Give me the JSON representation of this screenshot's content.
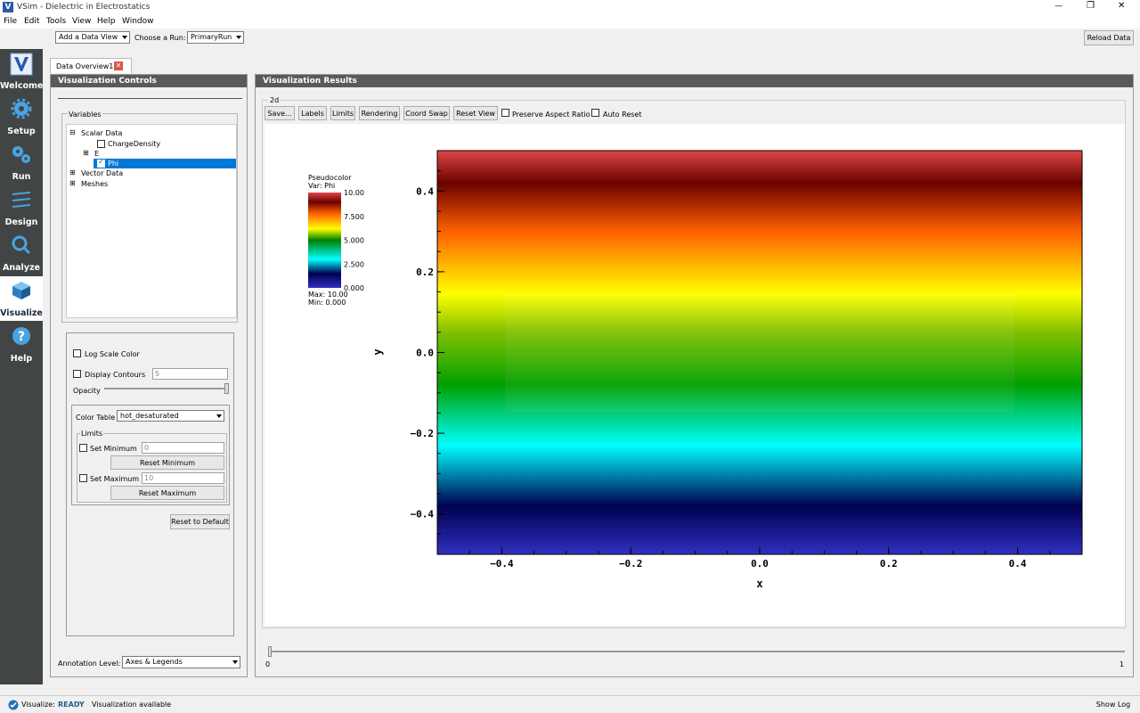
{
  "window": {
    "title": "VSim - Dielectric in Electrostatics",
    "controls": {
      "minimize": "—",
      "restore": "❐",
      "close": "✕"
    }
  },
  "menu": [
    "File",
    "Edit",
    "Tools",
    "View",
    "Help",
    "Window"
  ],
  "toolbar": {
    "data_view_label": "Add a Data View",
    "run_label": "Choose a Run:",
    "run_value": "PrimaryRun",
    "reload_label": "Reload Data"
  },
  "sidebar": [
    {
      "label": "Welcome",
      "icon": "vsim-logo-icon"
    },
    {
      "label": "Setup",
      "icon": "gear-icon"
    },
    {
      "label": "Run",
      "icon": "gears-icon"
    },
    {
      "label": "Design",
      "icon": "design-icon"
    },
    {
      "label": "Analyze",
      "icon": "magnifier-icon"
    },
    {
      "label": "Visualize",
      "icon": "cube-icon"
    },
    {
      "label": "Help",
      "icon": "help-icon"
    }
  ],
  "tab": {
    "label": "Data Overview1",
    "close_icon": "close-icon"
  },
  "controls_panel": {
    "title": "Visualization Controls",
    "variables_label": "Variables",
    "tree": {
      "scalar": "Scalar Data",
      "charge": "ChargeDensity",
      "e": "E",
      "phi": "Phi",
      "vector": "Vector Data",
      "meshes": "Meshes",
      "expand_glyph": "⊟",
      "collapsed_glyph": "⊞"
    },
    "log_scale_label": "Log Scale Color",
    "display_contours_label": "Display Contours",
    "contours_value": "5",
    "opacity_label": "Opacity",
    "color_table_label": "Color Table",
    "color_table_value": "hot_desaturated",
    "limits_label": "Limits",
    "set_min_label": "Set Minimum",
    "min_value": "0",
    "reset_min_label": "Reset Minimum",
    "set_max_label": "Set Maximum",
    "max_value": "10",
    "reset_max_label": "Reset Maximum",
    "reset_default_label": "Reset to Default",
    "annotation_label": "Annotation Level:",
    "annotation_value": "Axes & Legends"
  },
  "results_panel": {
    "title": "Visualization Results",
    "plot_label": "2d",
    "buttons": [
      "Save...",
      "Labels",
      "Limits",
      "Rendering",
      "Coord Swap",
      "Reset View"
    ],
    "preserve_label": "Preserve Aspect Ratio",
    "auto_reset_label": "Auto Reset",
    "slider_start": "0",
    "slider_end": "1"
  },
  "legend": {
    "title": "Pseudocolor",
    "var": "Var: Phi",
    "ticks": [
      "10.00",
      "7.500",
      "5.000",
      "2.500",
      "0.000"
    ],
    "max": "Max: 10.00",
    "min": "Min: 0.000"
  },
  "chart_data": {
    "type": "heatmap",
    "variable": "Phi",
    "xlabel": "x",
    "ylabel": "y",
    "xlim": [
      -0.5,
      0.5
    ],
    "ylim": [
      -0.5,
      0.5
    ],
    "x_ticks": [
      "-0.4",
      "-0.2",
      "0.0",
      "0.2",
      "0.4"
    ],
    "y_ticks": [
      "0.4",
      "0.2",
      "0.0",
      "-0.2",
      "-0.4"
    ],
    "value_range": [
      0,
      10
    ],
    "colormap": "hot_desaturated",
    "colormap_stops": [
      "#3030c0",
      "#000050",
      "#00ffff",
      "#008000",
      "#ffff00",
      "#ff6000",
      "#6b0000",
      "#e04848"
    ],
    "phi_profile_along_y": [
      {
        "y": -0.5,
        "phi": 0.0
      },
      {
        "y": -0.4,
        "phi": 1.0
      },
      {
        "y": -0.3,
        "phi": 2.5
      },
      {
        "y": -0.2,
        "phi": 3.7
      },
      {
        "y": -0.1,
        "phi": 4.6
      },
      {
        "y": 0.0,
        "phi": 5.0
      },
      {
        "y": 0.1,
        "phi": 5.4
      },
      {
        "y": 0.2,
        "phi": 7.2
      },
      {
        "y": 0.3,
        "phi": 8.6
      },
      {
        "y": 0.4,
        "phi": 9.6
      },
      {
        "y": 0.5,
        "phi": 10.0
      }
    ]
  },
  "status": {
    "label": "Visualize:",
    "state": "READY",
    "message": "Visualization available",
    "show_log_label": "Show Log"
  }
}
